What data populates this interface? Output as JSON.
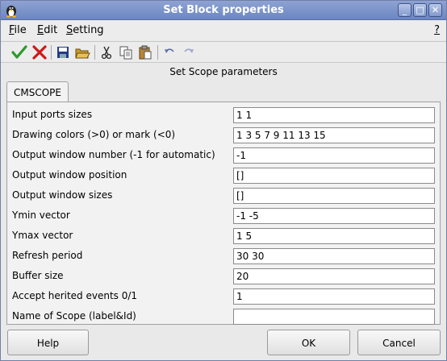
{
  "window": {
    "title": "Set Block properties"
  },
  "title_buttons": {
    "minimize": "_",
    "maximize": "□",
    "close": "✕"
  },
  "menu": {
    "file": {
      "label": "File",
      "underline": "F",
      "rest": "ile"
    },
    "edit": {
      "label": "Edit",
      "underline": "E",
      "rest": "dit"
    },
    "setting": {
      "label": "Setting",
      "underline": "S",
      "rest": "etting"
    },
    "help": "?"
  },
  "toolbar_icons": [
    "ok-check-icon",
    "cancel-x-icon",
    "save-icon",
    "open-folder-icon",
    "cut-icon",
    "copy-icon",
    "paste-icon",
    "undo-icon",
    "redo-icon"
  ],
  "header": "Set Scope parameters",
  "tab": "CMSCOPE",
  "params": [
    {
      "label": "Input ports sizes",
      "value": "1 1"
    },
    {
      "label": "Drawing colors (>0) or mark (<0)",
      "value": "1 3 5 7 9 11 13 15"
    },
    {
      "label": "Output window number (-1 for automatic)",
      "value": "-1"
    },
    {
      "label": "Output window position",
      "value": "[]"
    },
    {
      "label": "Output window sizes",
      "value": "[]"
    },
    {
      "label": "Ymin vector",
      "value": "-1 -5"
    },
    {
      "label": "Ymax vector",
      "value": "1 5"
    },
    {
      "label": "Refresh period",
      "value": "30 30"
    },
    {
      "label": "Buffer size",
      "value": "20"
    },
    {
      "label": "Accept herited events 0/1",
      "value": "1"
    },
    {
      "label": "Name of Scope (label&Id)",
      "value": ""
    }
  ],
  "buttons": {
    "help": "Help",
    "ok": "OK",
    "cancel": "Cancel"
  },
  "colors": {
    "titlebar": "#7a91c8",
    "ok_green": "#2a9a2a",
    "cancel_red": "#d01818"
  }
}
